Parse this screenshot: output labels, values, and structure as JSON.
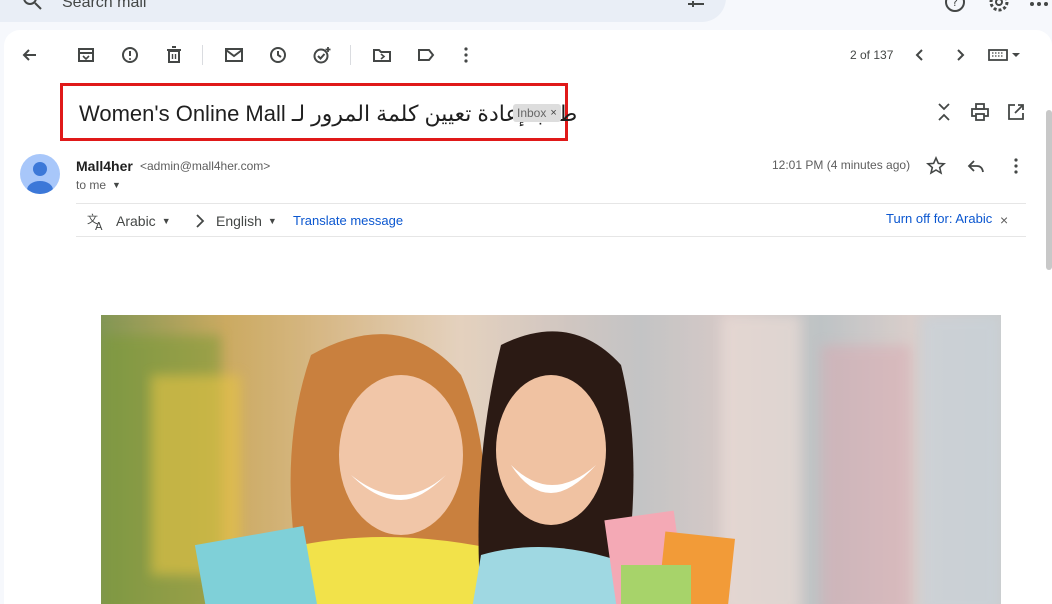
{
  "search": {
    "placeholder": "Search mail"
  },
  "toolbar": {
    "pager": "2 of 137"
  },
  "email": {
    "subject": "Women's Online Mall طلب إعادة تعيين كلمة المرور لـ",
    "label": "Inbox",
    "label_close": "×",
    "sender_name": "Mall4her",
    "sender_email": "<admin@mall4her.com>",
    "to": "to me",
    "time": "12:01 PM (4 minutes ago)"
  },
  "translate": {
    "from_lang": "Arabic",
    "to_lang": "English",
    "translate_link": "Translate message",
    "turn_off": "Turn off for: Arabic",
    "close": "×"
  },
  "colors": {
    "highlight_border": "#e01919",
    "link": "#0b57d0",
    "avatar": "#a8c7fa"
  }
}
